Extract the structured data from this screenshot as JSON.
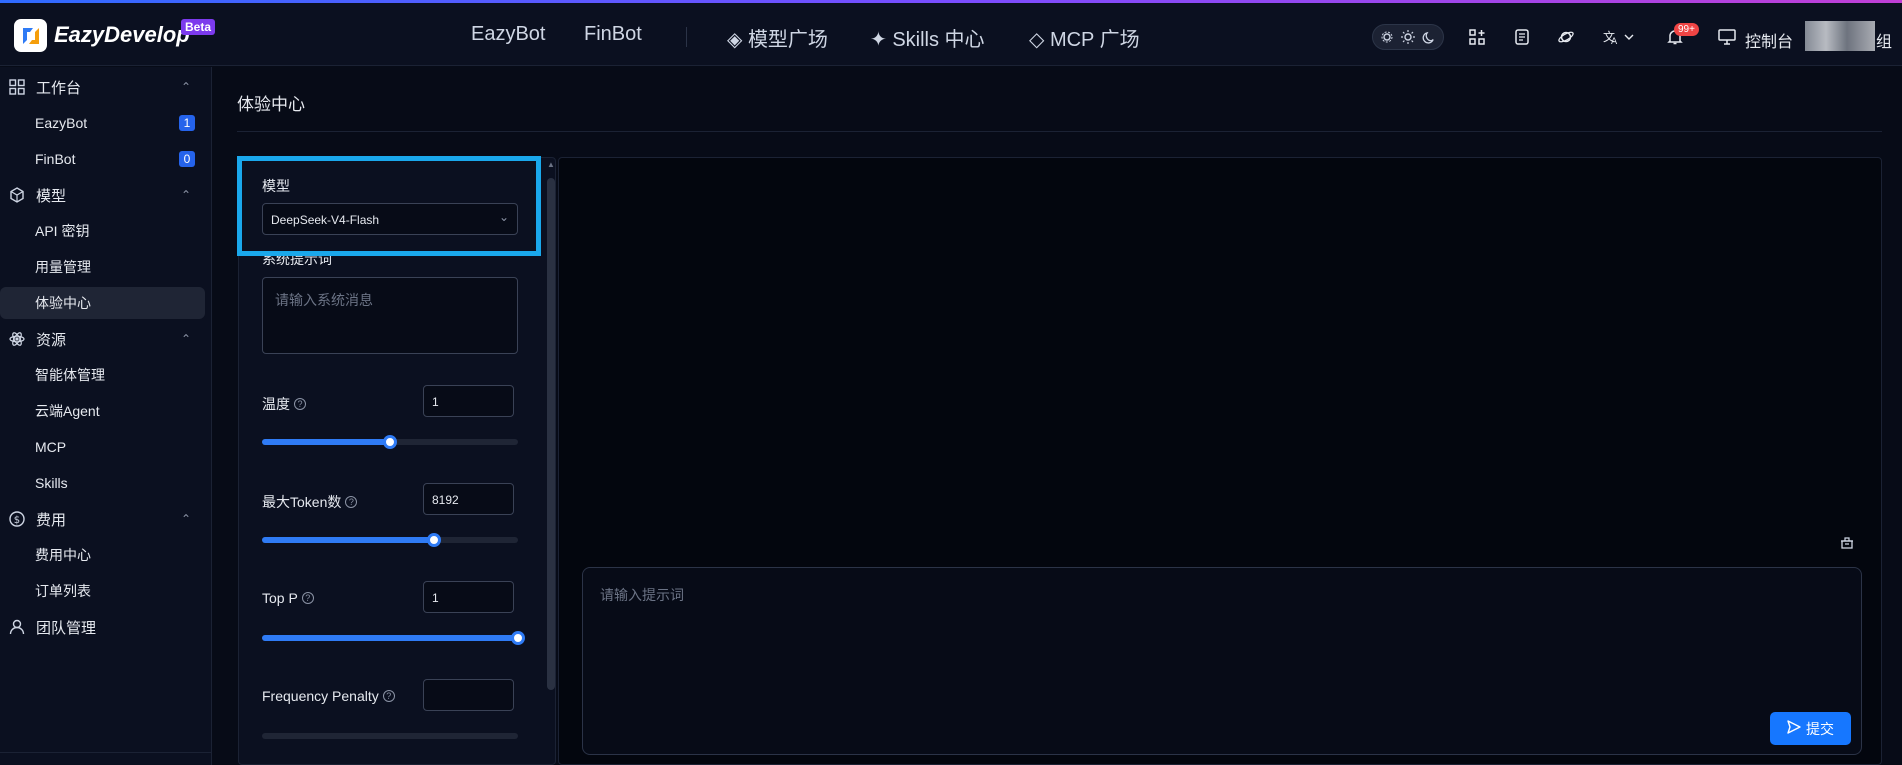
{
  "brand": {
    "name": "EazyDevelop",
    "badge": "Beta"
  },
  "topnav": {
    "items": [
      "EazyBot",
      "FinBot",
      "◈ 模型广场",
      "✦ Skills 中心",
      "◇ MCP 广场"
    ]
  },
  "header": {
    "notifications_badge": "99+",
    "console_label": "控制台",
    "user_suffix": "组",
    "icons": [
      "settings-mode-icon",
      "sun-icon",
      "moon-icon",
      "apps-icon",
      "docs-icon",
      "orbit-icon",
      "translate-icon",
      "bell-icon",
      "monitor-icon"
    ]
  },
  "sidebar": {
    "groups": [
      {
        "label": "工作台",
        "icon": "grid-icon",
        "items": [
          {
            "label": "EazyBot",
            "count": "1"
          },
          {
            "label": "FinBot",
            "count": "0"
          }
        ]
      },
      {
        "label": "模型",
        "icon": "cube-icon",
        "items": [
          {
            "label": "API 密钥"
          },
          {
            "label": "用量管理"
          },
          {
            "label": "体验中心",
            "active": true
          }
        ]
      },
      {
        "label": "资源",
        "icon": "atom-icon",
        "items": [
          {
            "label": "智能体管理"
          },
          {
            "label": "云端Agent"
          },
          {
            "label": "MCP"
          },
          {
            "label": "Skills"
          }
        ]
      },
      {
        "label": "费用",
        "icon": "dollar-icon",
        "items": [
          {
            "label": "费用中心"
          },
          {
            "label": "订单列表"
          }
        ]
      },
      {
        "label": "团队管理",
        "icon": "user-icon",
        "items": []
      }
    ]
  },
  "main": {
    "title": "体验中心",
    "model_label": "模型",
    "model_value": "DeepSeek-V4-Flash",
    "system_prompt_label": "系统提示词",
    "system_prompt_placeholder": "请输入系统消息",
    "params": [
      {
        "label": "温度",
        "value": "1",
        "fraction": 0.5
      },
      {
        "label": "最大Token数",
        "value": "8192",
        "fraction": 0.67
      },
      {
        "label": "Top P",
        "value": "1",
        "fraction": 1.0
      },
      {
        "label": "Frequency Penalty",
        "value": "",
        "fraction": 0.0
      }
    ],
    "prompt_placeholder": "请输入提示词",
    "submit_label": "提交"
  },
  "colors": {
    "accent": "#1677ff",
    "focus": "#1aa8ec",
    "beta": "#7c3aed",
    "badge": "#ef4444"
  }
}
